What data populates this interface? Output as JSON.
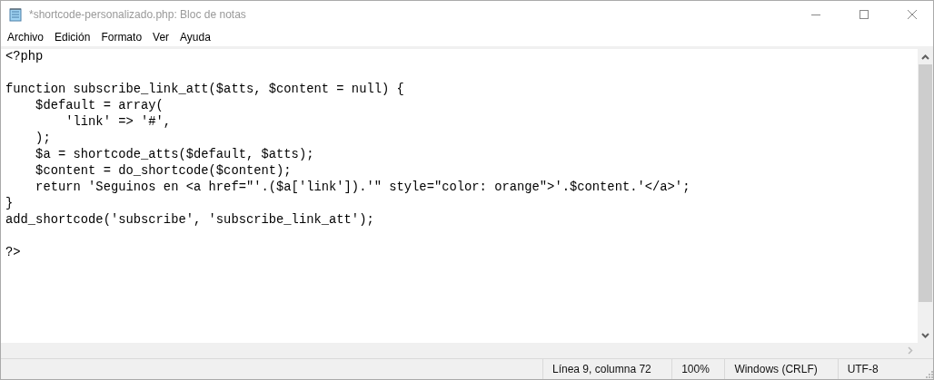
{
  "window": {
    "title": "*shortcode-personalizado.php: Bloc de notas"
  },
  "menu": [
    "Archivo",
    "Edición",
    "Formato",
    "Ver",
    "Ayuda"
  ],
  "editor": {
    "text": "<?php\n\nfunction subscribe_link_att($atts, $content = null) {\n    $default = array(\n        'link' => '#',\n    );\n    $a = shortcode_atts($default, $atts);\n    $content = do_shortcode($content);\n    return 'Seguinos en <a href=\"'.($a['link']).'\" style=\"color: orange\">'.$content.'</a>';\n}\nadd_shortcode('subscribe', 'subscribe_link_att');\n\n?>"
  },
  "status_bar": [
    "Línea 9, columna 72",
    "100%",
    "Windows (CRLF)",
    "UTF-8"
  ]
}
